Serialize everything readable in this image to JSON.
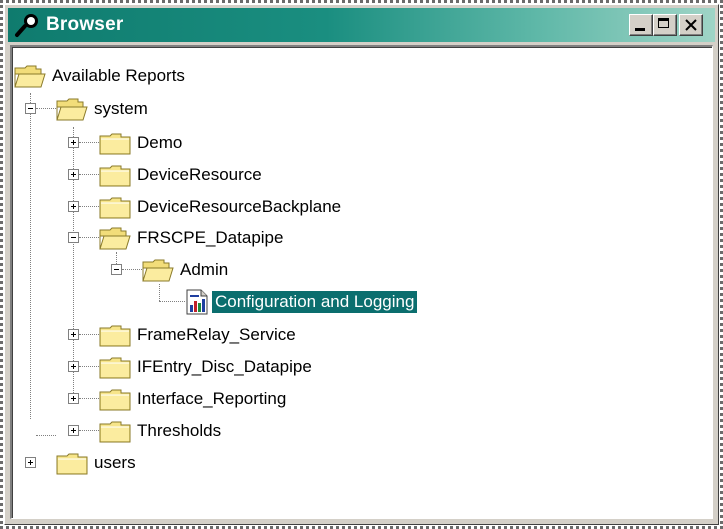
{
  "window": {
    "title": "Browser",
    "title_icon": "magnifier-icon",
    "buttons": [
      "minimize",
      "maximize",
      "close"
    ]
  },
  "colors": {
    "titlebar": "#0f7b6e",
    "selection": "#0b6e6e"
  },
  "tree": {
    "root": "Available Reports",
    "system": "system",
    "demo": "Demo",
    "device_resource": "DeviceResource",
    "device_resource_backplane": "DeviceResourceBackplane",
    "frscpe_datapipe": "FRSCPE_Datapipe",
    "admin": "Admin",
    "config_logging": "Configuration and Logging",
    "framerelay_service": "FrameRelay_Service",
    "ifentry_disc": "IFEntry_Disc_Datapipe",
    "interface_reporting": "Interface_Reporting",
    "thresholds": "Thresholds",
    "users": "users",
    "selected": "Configuration and Logging"
  }
}
